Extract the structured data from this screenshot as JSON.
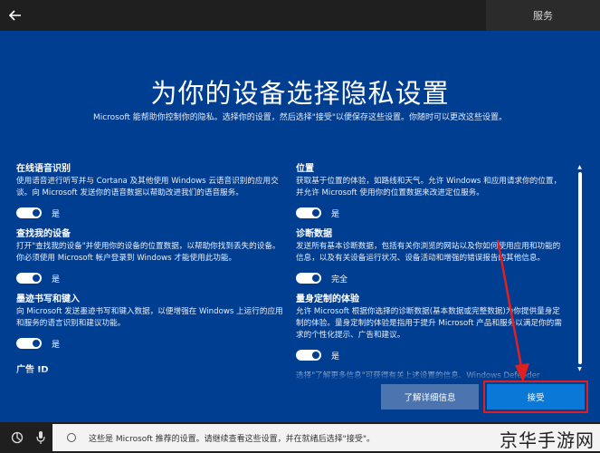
{
  "topbar": {
    "right_label": "服务"
  },
  "header": {
    "title": "为你的设备选择隐私设置",
    "subtitle": "Microsoft 能帮助你控制你的隐私。选择你的设置，然后选择\"接受\"以便保存这些设置。你随时可以更改这些设置。"
  },
  "left_column": [
    {
      "title": "在线语音识别",
      "desc": "使用语音进行听写并与 Cortana 及其他使用 Windows 云语音识别的应用交谈。向 Microsoft 发送你的语音数据以帮助改进我们的语音服务。",
      "toggle_label": "是"
    },
    {
      "title": "查找我的设备",
      "desc": "打开\"查找我的设备\"并使用你的设备的位置数据，以帮助你找到丢失的设备。你必须使用 Microsoft 帐户登录到 Windows 才能使用此功能。",
      "toggle_label": "是"
    },
    {
      "title": "墨迹书写和键入",
      "desc": "向 Microsoft 发送墨迹书写和键入数据，以便增强在 Windows 上运行的应用和服务的语言识别和建议功能。",
      "toggle_label": "是"
    },
    {
      "title": "广告 ID"
    }
  ],
  "right_column": [
    {
      "title": "位置",
      "desc": "获取基于位置的体验，如路线和天气。允许 Windows 和应用请求你的位置，并允许 Microsoft 使用你的位置数据来改进定位服务。",
      "toggle_label": "是"
    },
    {
      "title": "诊断数据",
      "desc": "发送所有基本诊断数据，包括有关你浏览的网站以及你如何使用应用和功能的信息，以及有关设备运行状况、设备活动和增强的错误报告的其他信息。",
      "toggle_label": "完全"
    },
    {
      "title": "量身定制的体验",
      "desc": "允许 Microsoft 根据你选择的诊断数据(基本数据或完整数据)为你提供量身定制的体验。量身定制的体验是指用于提升 Microsoft 产品和服务以满足你的需求的个性化提示、广告和建议。",
      "toggle_label": "是"
    },
    {
      "desc": "选择\"了解更多信息\"可获得有关上述设置的信息、Windows Defender"
    }
  ],
  "buttons": {
    "learn_more": "了解详细信息",
    "accept": "接受"
  },
  "bottombar": {
    "narrator_text": "这些是 Microsoft 推荐的设置。请继续查看这些设置，并在就绪后选择\"接受\"。",
    "watermark": "京华手游网"
  },
  "colors": {
    "background": "#003e92",
    "accent": "#0a78d7",
    "highlight": "#e21f1f"
  },
  "icons": [
    "back-arrow-icon",
    "accessibility-icon",
    "microphone-icon",
    "narrator-circle-icon"
  ]
}
